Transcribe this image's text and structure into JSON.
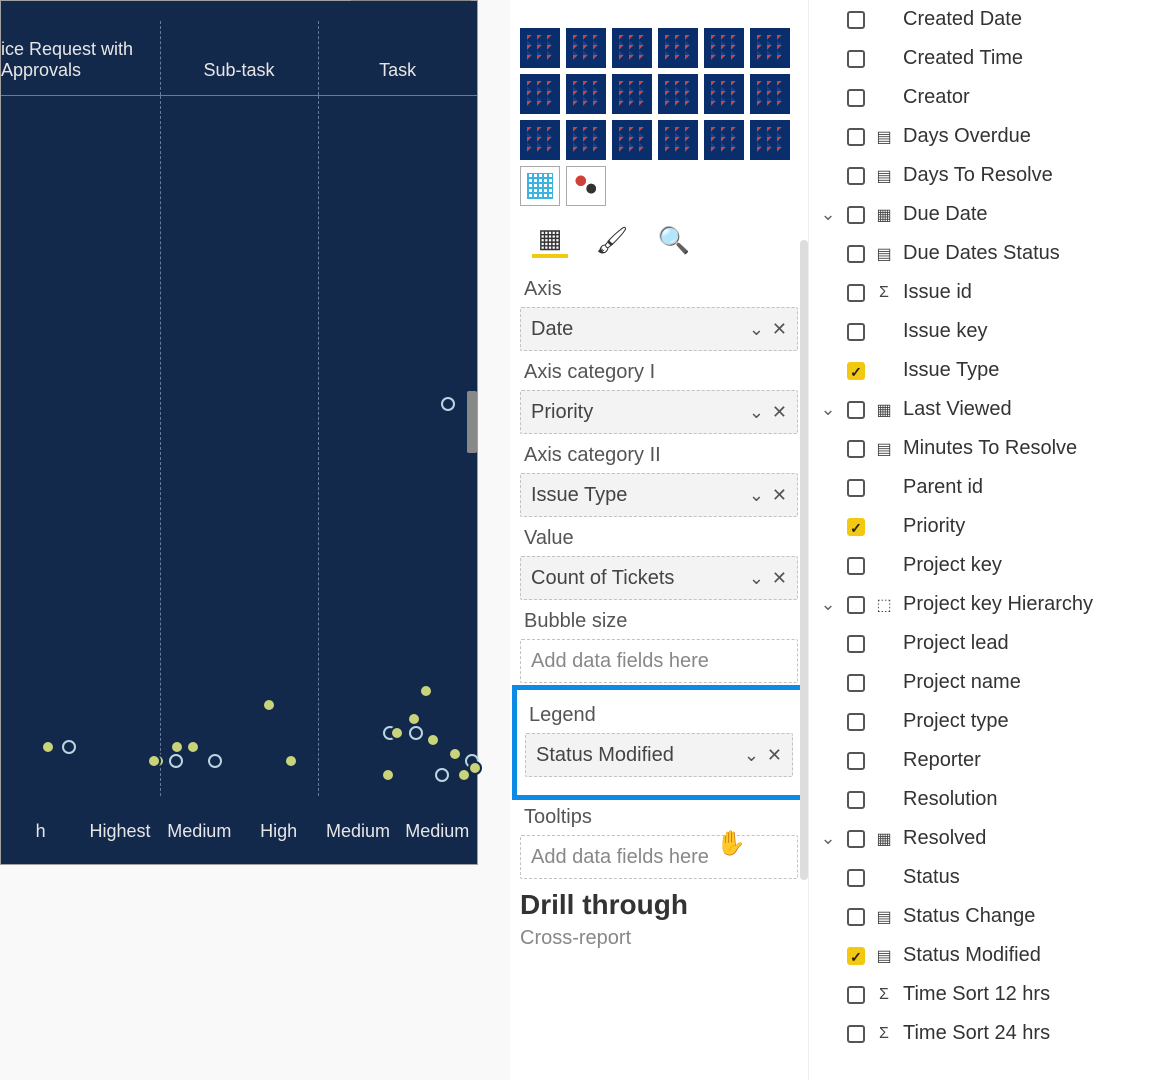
{
  "chart": {
    "headers": [
      "ice Request with Approvals",
      "Sub-task",
      "Task"
    ],
    "footers": [
      "h",
      "Highest",
      "Medium",
      "High",
      "Medium",
      "Medium"
    ]
  },
  "vis": {
    "tabs": {
      "fields": "▦",
      "format": "🖌",
      "analytics": "🔍"
    },
    "wells": [
      {
        "label": "Axis",
        "value": "Date",
        "empty": false
      },
      {
        "label": "Axis category I",
        "value": "Priority",
        "empty": false
      },
      {
        "label": "Axis category II",
        "value": "Issue Type",
        "empty": false
      },
      {
        "label": "Value",
        "value": "Count of Tickets",
        "empty": false
      },
      {
        "label": "Bubble size",
        "value": "Add data fields here",
        "empty": true
      },
      {
        "label": "Legend",
        "value": "Status Modified",
        "empty": false,
        "highlight": true
      },
      {
        "label": "Tooltips",
        "value": "Add data fields here",
        "empty": true
      }
    ],
    "drill": "Drill through",
    "drill_sub": "Cross-report"
  },
  "fields": [
    {
      "chev": "",
      "chk": false,
      "icon": "",
      "label": "Created Date"
    },
    {
      "chev": "",
      "chk": false,
      "icon": "",
      "label": "Created Time"
    },
    {
      "chev": "",
      "chk": false,
      "icon": "",
      "label": "Creator"
    },
    {
      "chev": "",
      "chk": false,
      "icon": "▤",
      "label": "Days Overdue"
    },
    {
      "chev": "",
      "chk": false,
      "icon": "▤",
      "label": "Days To Resolve"
    },
    {
      "chev": "v",
      "chk": false,
      "icon": "▦",
      "label": "Due Date"
    },
    {
      "chev": "",
      "chk": false,
      "icon": "▤",
      "label": "Due Dates Status"
    },
    {
      "chev": "",
      "chk": false,
      "icon": "Σ",
      "label": "Issue id"
    },
    {
      "chev": "",
      "chk": false,
      "icon": "",
      "label": "Issue key"
    },
    {
      "chev": "",
      "chk": true,
      "icon": "",
      "label": "Issue Type"
    },
    {
      "chev": "v",
      "chk": false,
      "icon": "▦",
      "label": "Last Viewed"
    },
    {
      "chev": "",
      "chk": false,
      "icon": "▤",
      "label": "Minutes To Resolve"
    },
    {
      "chev": "",
      "chk": false,
      "icon": "",
      "label": "Parent id"
    },
    {
      "chev": "",
      "chk": true,
      "icon": "",
      "label": "Priority"
    },
    {
      "chev": "",
      "chk": false,
      "icon": "",
      "label": "Project key"
    },
    {
      "chev": "v",
      "chk": false,
      "icon": "⬚",
      "label": "Project key Hierarchy"
    },
    {
      "chev": "",
      "chk": false,
      "icon": "",
      "label": "Project lead"
    },
    {
      "chev": "",
      "chk": false,
      "icon": "",
      "label": "Project name"
    },
    {
      "chev": "",
      "chk": false,
      "icon": "",
      "label": "Project type"
    },
    {
      "chev": "",
      "chk": false,
      "icon": "",
      "label": "Reporter"
    },
    {
      "chev": "",
      "chk": false,
      "icon": "",
      "label": "Resolution"
    },
    {
      "chev": "v",
      "chk": false,
      "icon": "▦",
      "label": "Resolved"
    },
    {
      "chev": "",
      "chk": false,
      "icon": "",
      "label": "Status"
    },
    {
      "chev": "",
      "chk": false,
      "icon": "▤",
      "label": "Status Change"
    },
    {
      "chev": "",
      "chk": true,
      "icon": "▤",
      "label": "Status Modified"
    },
    {
      "chev": "",
      "chk": false,
      "icon": "Σ",
      "label": "Time Sort 12 hrs"
    },
    {
      "chev": "",
      "chk": false,
      "icon": "Σ",
      "label": "Time Sort 24 hrs"
    }
  ],
  "chart_data": {
    "type": "scatter",
    "title": "",
    "axis_category_i_values": [
      "h",
      "Highest",
      "Medium",
      "High",
      "Medium",
      "Medium"
    ],
    "axis_category_ii_values": [
      "ice Request with Approvals",
      "Sub-task",
      "Task"
    ],
    "value_field": "Count of Tickets",
    "legend_field": "Status Modified",
    "points_estimated": [
      {
        "col": 0,
        "y": 0.06
      },
      {
        "col": 0,
        "y": 0.06
      },
      {
        "col": 1,
        "y": 0.04
      },
      {
        "col": 1,
        "y": 0.04
      },
      {
        "col": 2,
        "y": 0.04
      },
      {
        "col": 2,
        "y": 0.06
      },
      {
        "col": 2,
        "y": 0.06
      },
      {
        "col": 2,
        "y": 0.04
      },
      {
        "col": 3,
        "y": 0.12
      },
      {
        "col": 3,
        "y": 0.04
      },
      {
        "col": 4,
        "y": 0.08
      },
      {
        "col": 4,
        "y": 0.08
      },
      {
        "col": 4,
        "y": 0.02
      },
      {
        "col": 5,
        "y": 0.55
      },
      {
        "col": 5,
        "y": 0.14
      },
      {
        "col": 5,
        "y": 0.1
      },
      {
        "col": 5,
        "y": 0.08
      },
      {
        "col": 5,
        "y": 0.07
      },
      {
        "col": 5,
        "y": 0.05
      },
      {
        "col": 5,
        "y": 0.04
      },
      {
        "col": 5,
        "y": 0.03
      },
      {
        "col": 5,
        "y": 0.02
      },
      {
        "col": 5,
        "y": 0.02
      }
    ]
  }
}
